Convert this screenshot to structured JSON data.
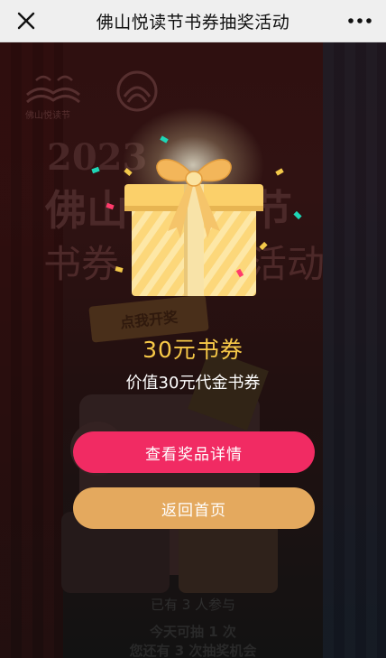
{
  "topbar": {
    "title": "佛山悦读节书券抽奖活动",
    "close_icon": "close-icon",
    "more_icon": "more-icon"
  },
  "background": {
    "logo_name": "佛山悦读节",
    "year": "2023",
    "city_start": "佛山",
    "city_end": "节",
    "subtitle_start": "书券",
    "subtitle_end": "活动",
    "tag": "点我开奖",
    "participants": "已有 3 人参与",
    "today_draws": "今天可抽 1 次",
    "remaining_chances": "您还有 3 次抽奖机会"
  },
  "prize": {
    "title": "30元书券",
    "description": "价值30元代金书券",
    "gift_icon": "gift-box-icon"
  },
  "buttons": {
    "detail": "查看奖品详情",
    "home": "返回首页"
  },
  "colors": {
    "prize_title": "#f7c948",
    "detail_button": "#f12b63",
    "home_button": "#e4a95e",
    "gift_body": "#fcd77a"
  }
}
